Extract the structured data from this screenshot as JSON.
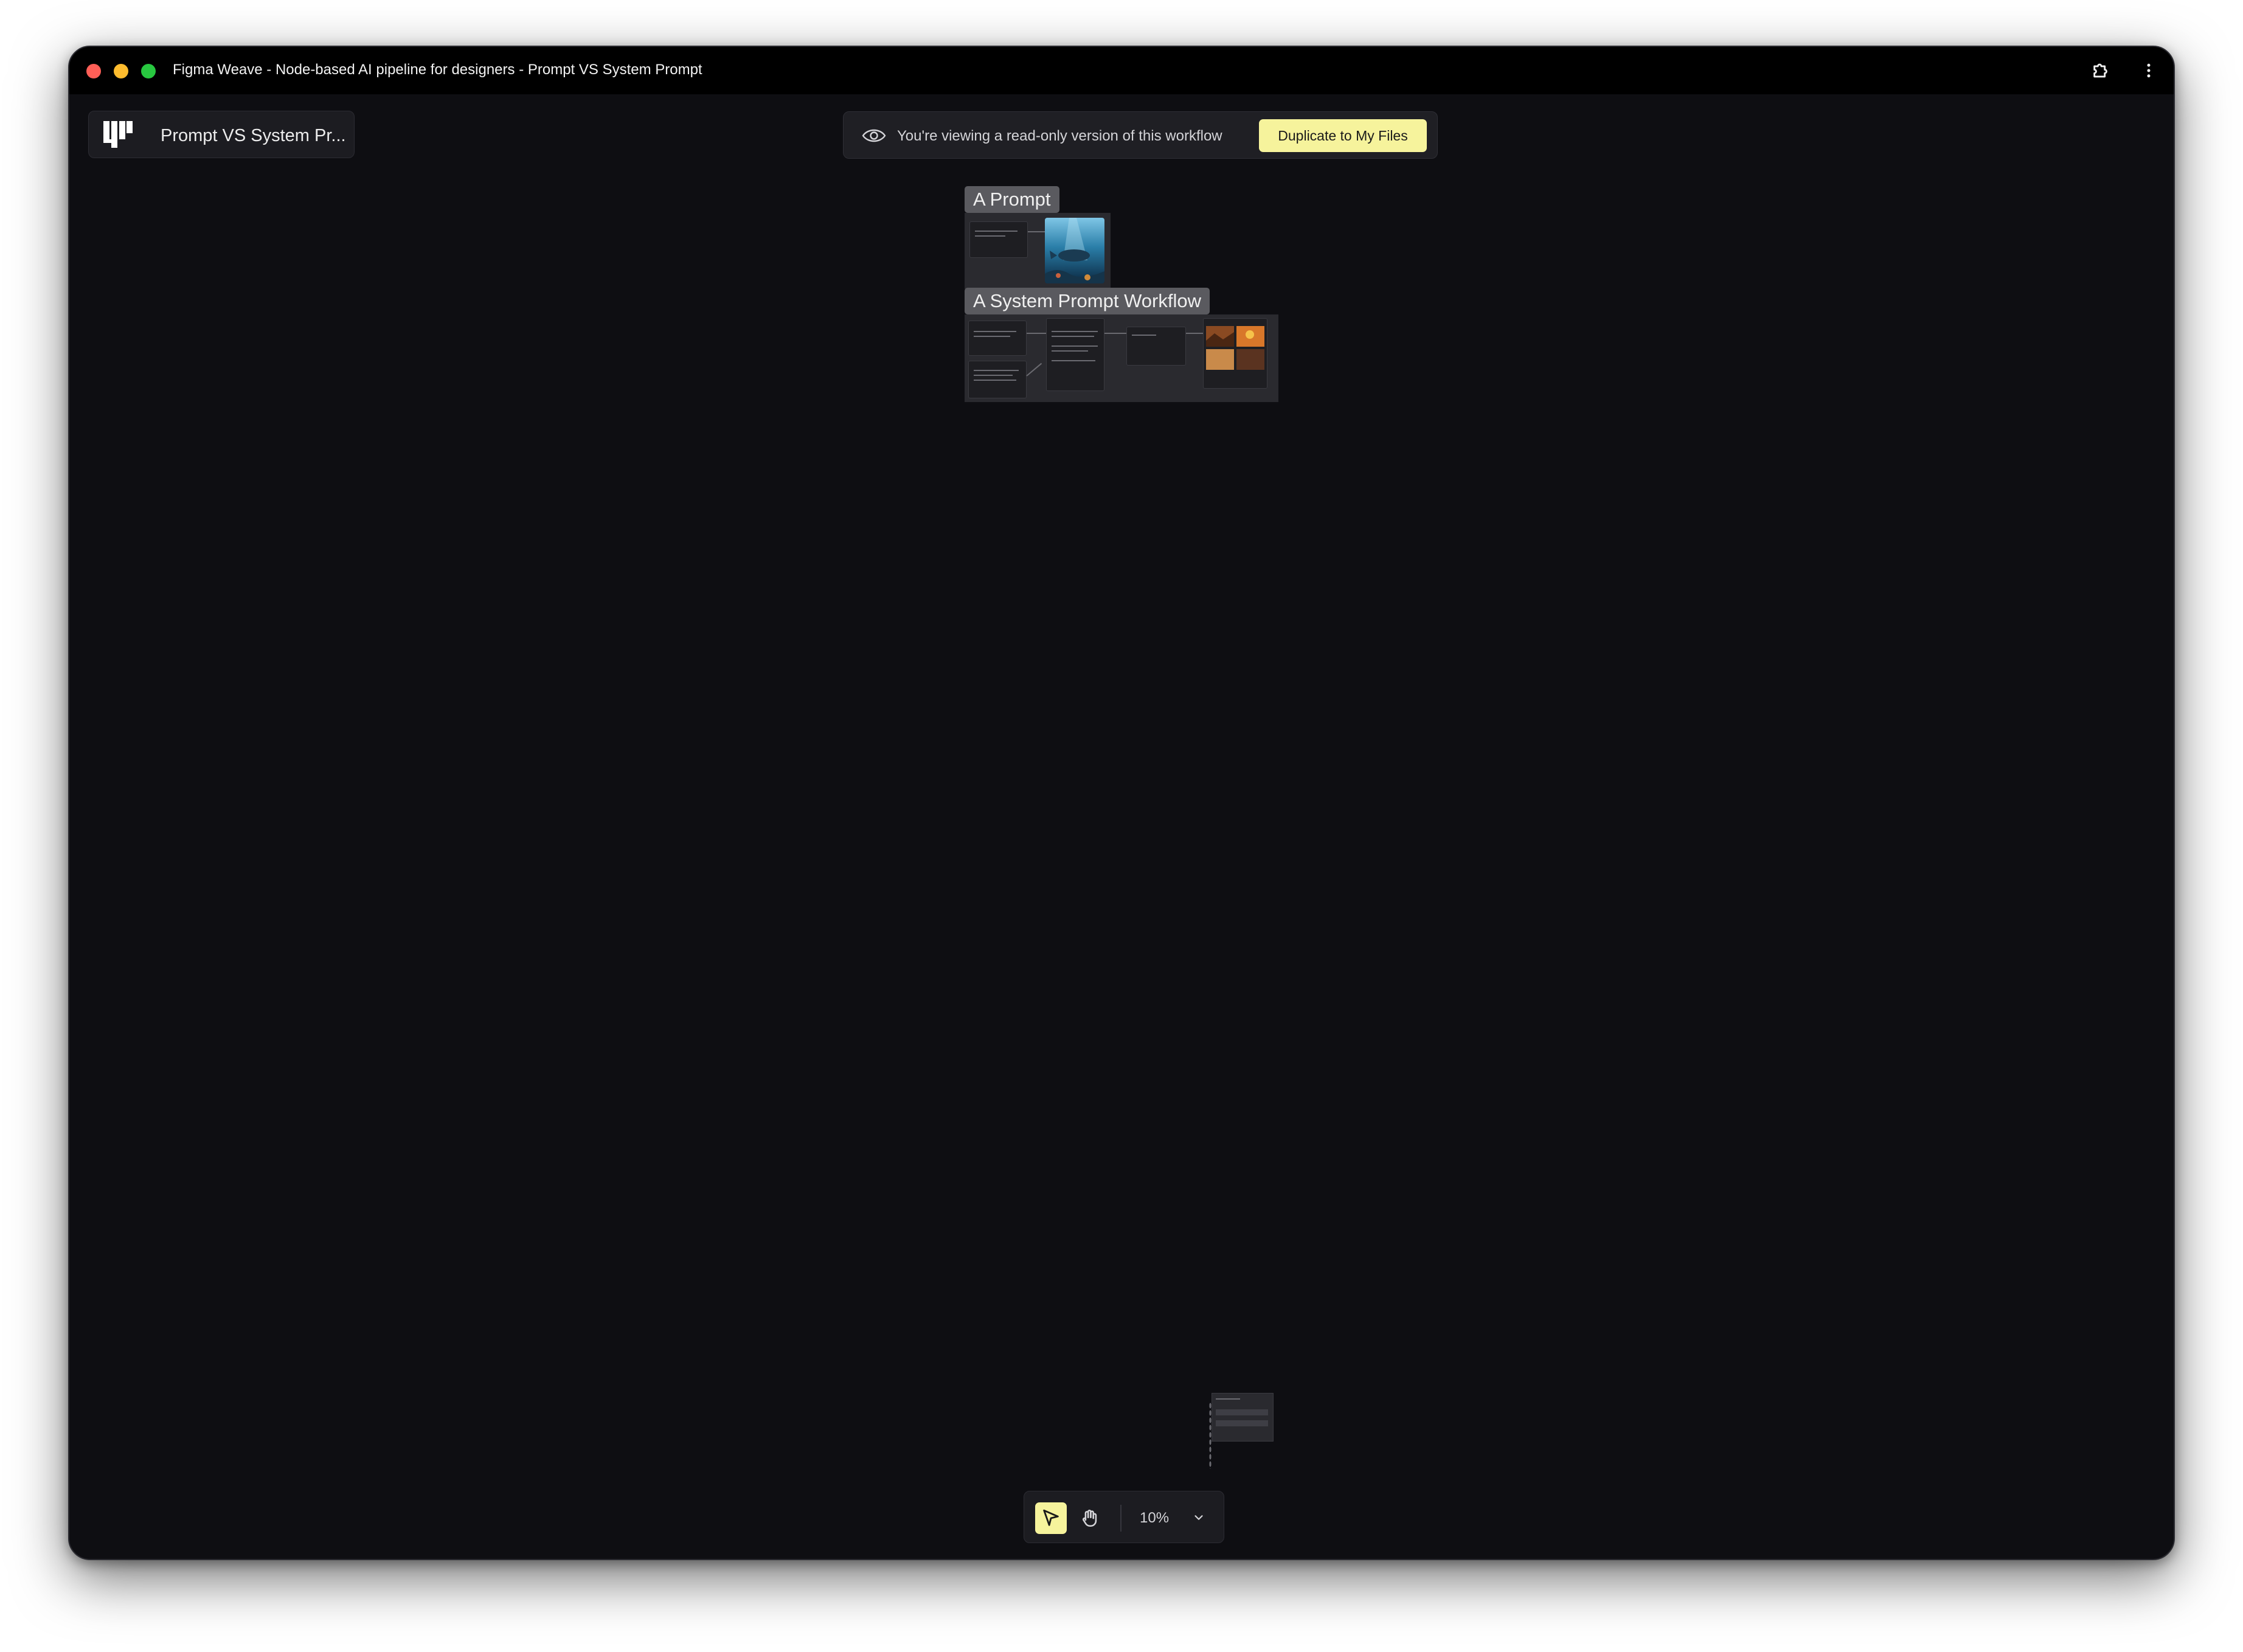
{
  "window": {
    "title": "Figma Weave - Node-based AI pipeline for designers - Prompt VS System Prompt"
  },
  "project": {
    "name": "Prompt VS System Pr..."
  },
  "readonly_banner": {
    "message": "You're viewing a read-only version of this workflow",
    "duplicate_label": "Duplicate to My Files"
  },
  "canvas": {
    "groups": [
      {
        "label": "A Prompt"
      },
      {
        "label": "A System Prompt Workflow"
      }
    ]
  },
  "toolbar": {
    "zoom": "10%",
    "tools": [
      "select-tool",
      "hand-tool"
    ]
  },
  "icons": {
    "logo": "weave-logo-icon",
    "eye": "eye-icon",
    "extensions": "puzzle-icon",
    "more": "more-vertical-icon",
    "select": "cursor-arrow-icon",
    "hand": "hand-icon",
    "zoom_menu": "chevron-down-icon"
  },
  "colors": {
    "accent": "#f6f39c",
    "canvas_bg": "#0e0e12",
    "panel_bg": "#1c1c21"
  }
}
